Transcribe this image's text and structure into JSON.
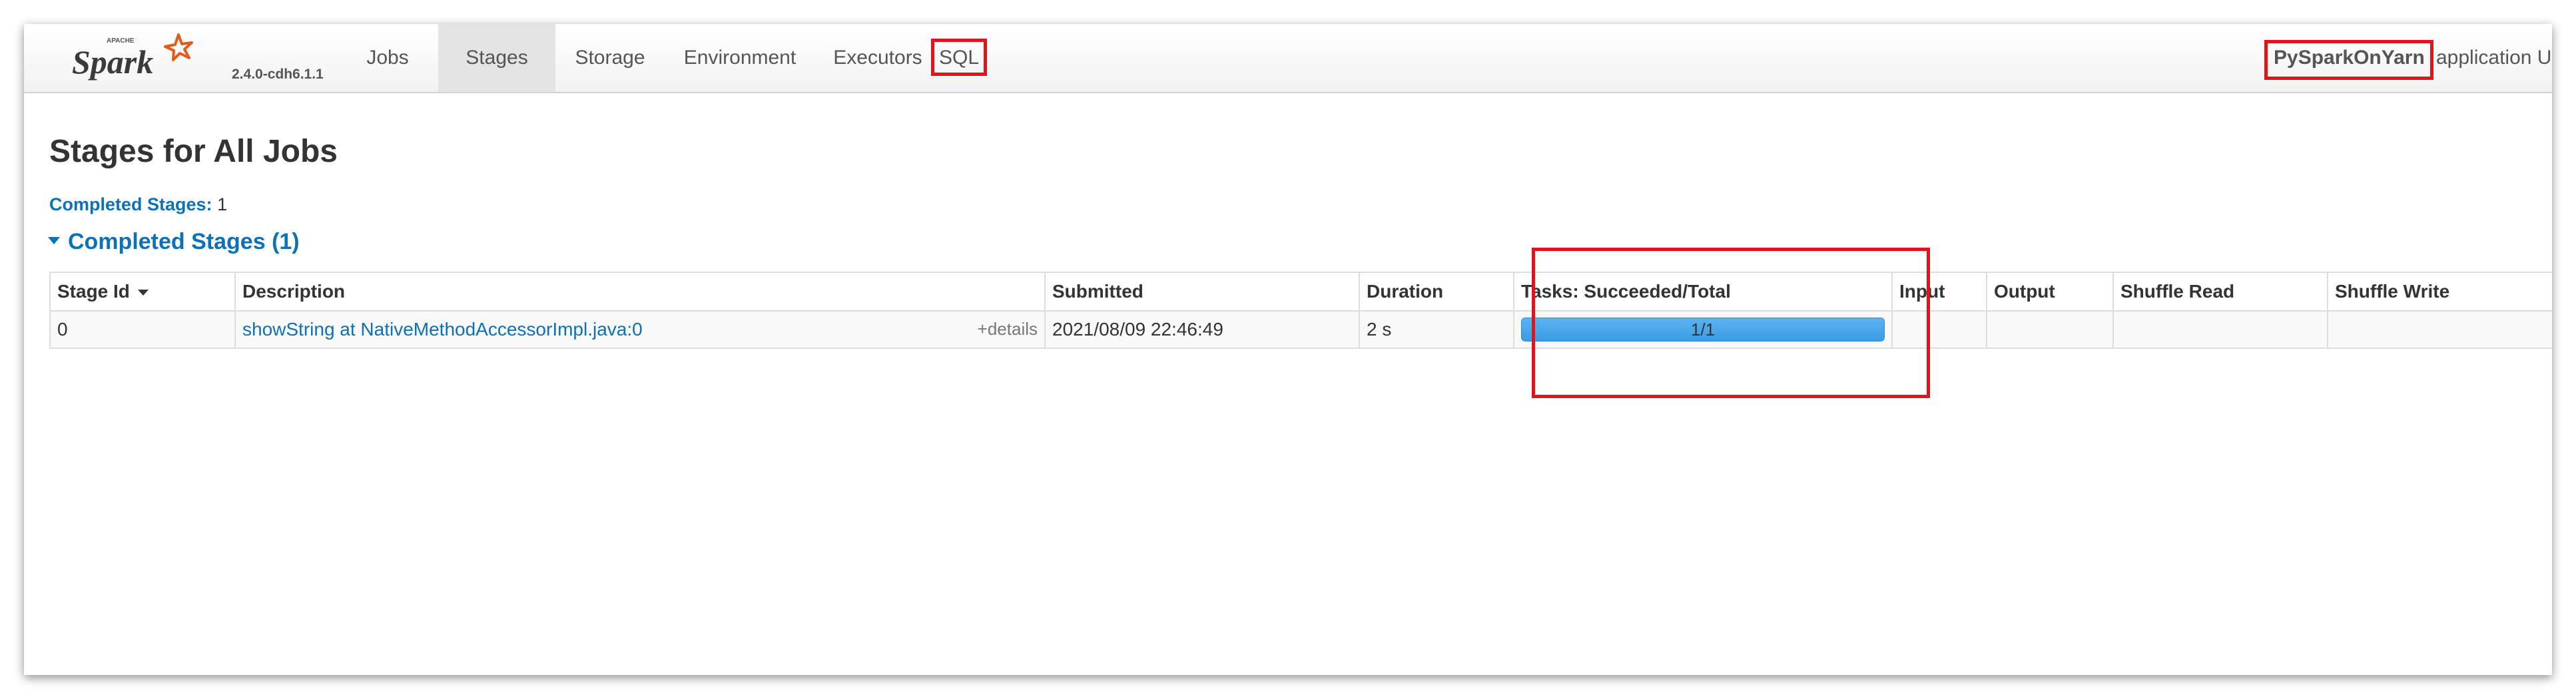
{
  "brand": {
    "logo_top_text": "APACHE",
    "logo_text": "Spark",
    "version": "2.4.0-cdh6.1.1"
  },
  "nav": {
    "tabs": [
      {
        "label": "Jobs",
        "active": false
      },
      {
        "label": "Stages",
        "active": true
      },
      {
        "label": "Storage",
        "active": false
      },
      {
        "label": "Environment",
        "active": false
      },
      {
        "label": "Executors",
        "active": false
      },
      {
        "label": "SQL",
        "active": false,
        "highlighted": true
      }
    ],
    "app_name": "PySparkOnYarn",
    "app_suffix": "application UI"
  },
  "page": {
    "title": "Stages for All Jobs",
    "summary_label": "Completed Stages:",
    "summary_value": "1",
    "section_title": "Completed Stages (1)"
  },
  "table": {
    "headers": [
      "Stage Id",
      "Description",
      "Submitted",
      "Duration",
      "Tasks: Succeeded/Total",
      "Input",
      "Output",
      "Shuffle Read",
      "Shuffle Write"
    ],
    "rows": [
      {
        "stage_id": "0",
        "description": "showString at NativeMethodAccessorImpl.java:0",
        "details": "+details",
        "submitted": "2021/08/09 22:46:49",
        "duration": "2 s",
        "tasks_text": "1/1",
        "tasks_succeeded": 1,
        "tasks_total": 1,
        "input": "",
        "output": "",
        "shuffle_read": "",
        "shuffle_write": ""
      }
    ]
  },
  "colors": {
    "link": "#0c71b8",
    "highlight_box": "#e0151b",
    "progress_fill": "#3a9ce4",
    "logo_star": "#e25a1c"
  }
}
